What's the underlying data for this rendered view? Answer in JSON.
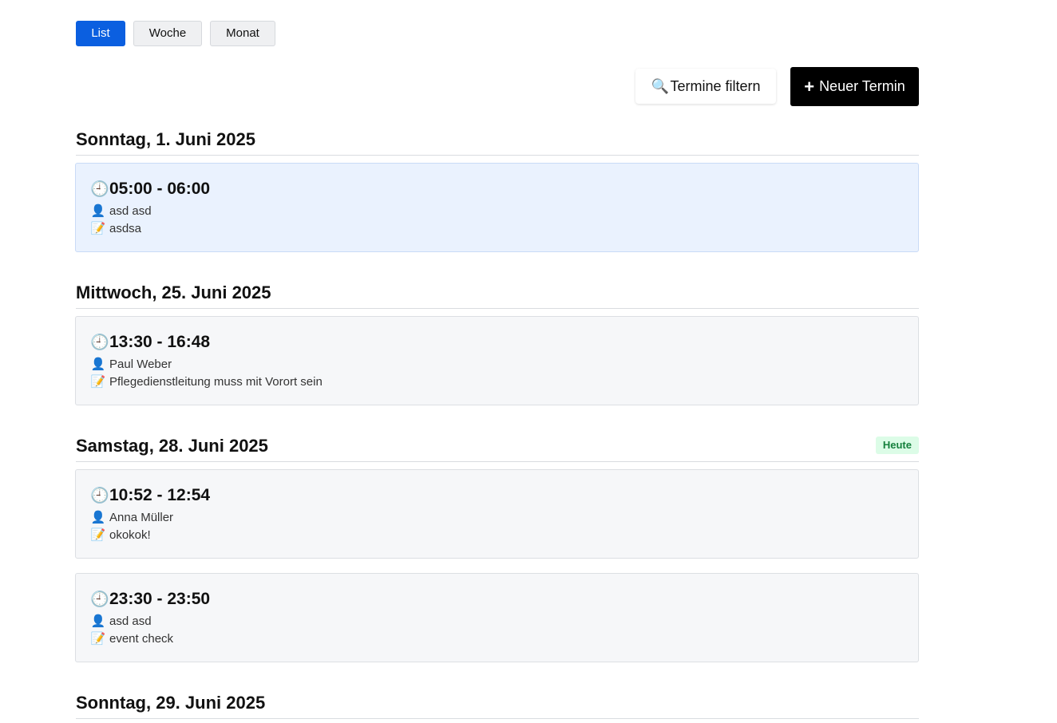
{
  "view_tabs": [
    {
      "label": "List",
      "active": true
    },
    {
      "label": "Woche",
      "active": false
    },
    {
      "label": "Monat",
      "active": false
    }
  ],
  "toolbar": {
    "filter_label": "Termine filtern",
    "filter_icon": "magnifier-icon",
    "new_label": "Neuer Termin",
    "new_icon": "plus-icon"
  },
  "colors": {
    "accent": "#0b5fe0",
    "primary_button": "#000000",
    "today_badge_bg": "#dcfce7",
    "today_badge_text": "#15803d",
    "highlight_card": "#eaf2fe"
  },
  "days": [
    {
      "title": "Sonntag, 1. Juni 2025",
      "badge": "",
      "events": [
        {
          "time": "05:00 - 06:00",
          "person": "asd asd",
          "note": "asdsa",
          "highlight": true
        }
      ]
    },
    {
      "title": "Mittwoch, 25. Juni 2025",
      "badge": "",
      "events": [
        {
          "time": "13:30 - 16:48",
          "person": "Paul Weber",
          "note": "Pflegedienstleitung muss mit Vorort sein",
          "highlight": false
        }
      ]
    },
    {
      "title": "Samstag, 28. Juni 2025",
      "badge": "Heute",
      "events": [
        {
          "time": "10:52 - 12:54",
          "person": "Anna Müller",
          "note": "okokok!",
          "highlight": false
        },
        {
          "time": "23:30 - 23:50",
          "person": "asd asd",
          "note": "event check",
          "highlight": false
        }
      ]
    },
    {
      "title": "Sonntag, 29. Juni 2025",
      "badge": "",
      "events": []
    }
  ]
}
